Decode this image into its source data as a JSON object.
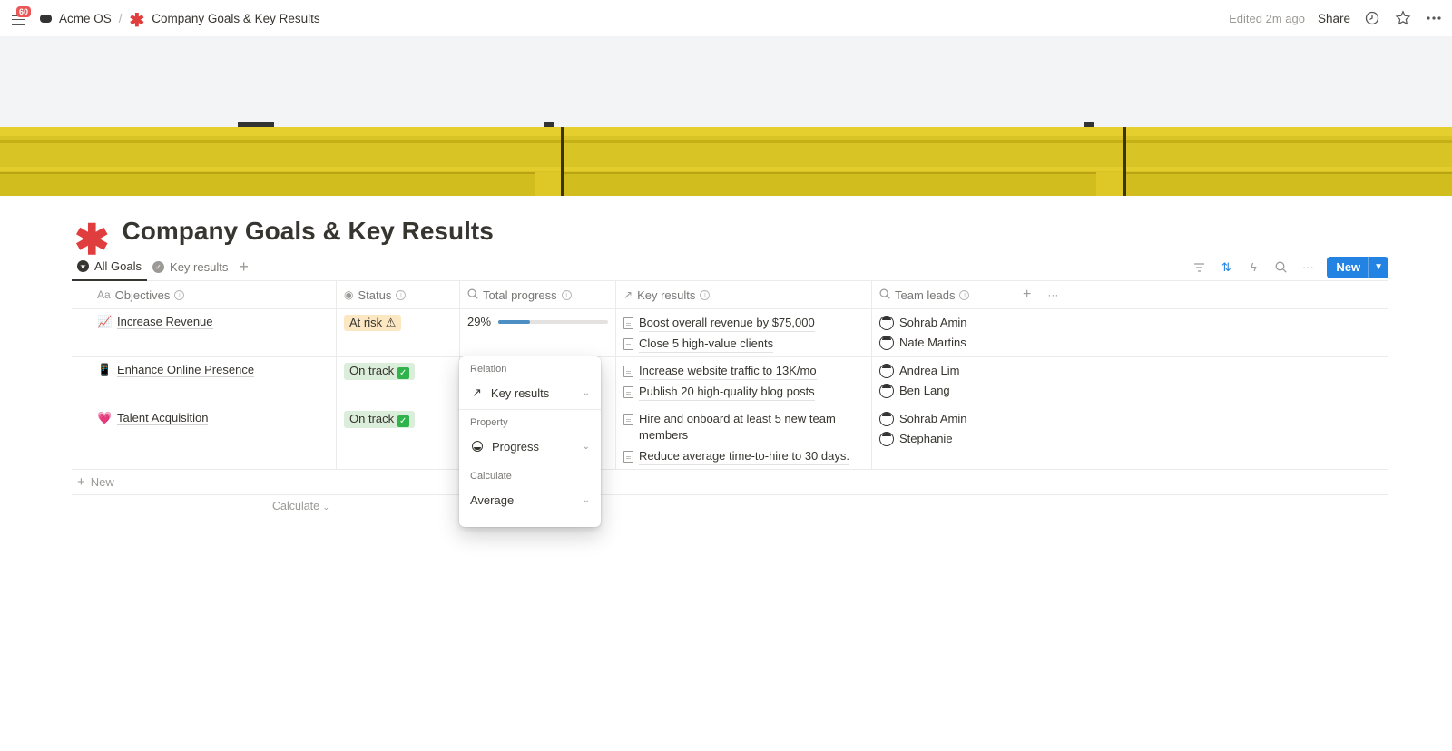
{
  "topbar": {
    "notification_count": "60",
    "workspace": "Acme OS",
    "separator": "/",
    "page_name": "Company Goals & Key Results",
    "edited": "Edited 2m ago",
    "share_label": "Share"
  },
  "page": {
    "title": "Company Goals & Key Results",
    "icon": "✱"
  },
  "views": {
    "tabs": [
      {
        "label": "All Goals",
        "active": true
      },
      {
        "label": "Key results",
        "active": false
      }
    ],
    "new_label": "New"
  },
  "table": {
    "columns": [
      {
        "label": "Objectives",
        "icon": "Aa"
      },
      {
        "label": "Status",
        "icon": "status-icon"
      },
      {
        "label": "Total progress",
        "icon": "search-icon"
      },
      {
        "label": "Key results",
        "icon": "arrow-up-right-icon"
      },
      {
        "label": "Team leads",
        "icon": "search-icon"
      }
    ],
    "rows": [
      {
        "emoji": "📈",
        "objective": "Increase Revenue",
        "status": "At risk ⚠",
        "status_type": "risk",
        "progress_label": "29%",
        "progress": 0.29,
        "key_results": [
          "Boost overall revenue by $75,000",
          "Close 5 high-value clients"
        ],
        "leads": [
          "Sohrab Amin",
          "Nate Martins"
        ]
      },
      {
        "emoji": "📱",
        "objective": "Enhance Online Presence",
        "status": "On track",
        "status_type": "ok",
        "progress_label": "",
        "progress": null,
        "key_results": [
          "Increase website traffic to 13K/mo",
          "Publish 20 high-quality blog posts"
        ],
        "leads": [
          "Andrea Lim",
          "Ben Lang"
        ]
      },
      {
        "emoji": "💗",
        "objective": "Talent Acquisition",
        "status": "On track",
        "status_type": "ok",
        "progress_label": "",
        "progress": null,
        "key_results": [
          "Hire and onboard at least 5 new team members",
          "Reduce average time-to-hire to 30 days."
        ],
        "leads": [
          "Sohrab Amin",
          "Stephanie"
        ]
      }
    ],
    "new_row_label": "New",
    "calculate_label": "Calculate"
  },
  "popup": {
    "relation_label": "Relation",
    "relation_value": "Key results",
    "property_label": "Property",
    "property_value": "Progress",
    "calculate_label": "Calculate",
    "calculate_value": "Average"
  }
}
